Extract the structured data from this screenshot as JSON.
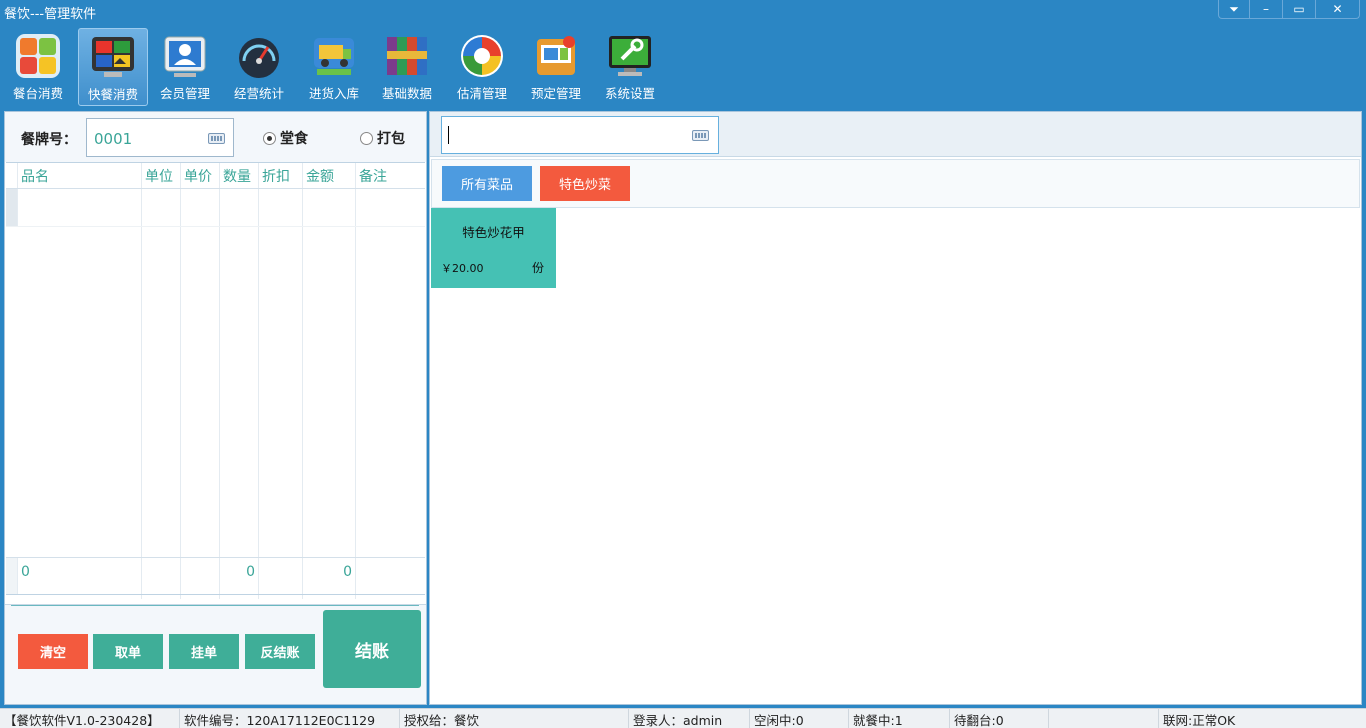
{
  "window": {
    "title": "餐饮---管理软件",
    "controls": {
      "menu": "⏷",
      "minimize": "–",
      "maximize": "▭",
      "close": "✕"
    }
  },
  "toolbar": {
    "items": [
      {
        "label": "餐台消费",
        "icon": "tiles-icon",
        "active": false
      },
      {
        "label": "快餐消费",
        "icon": "fastfood-icon",
        "active": true
      },
      {
        "label": "会员管理",
        "icon": "member-icon",
        "active": false
      },
      {
        "label": "经营统计",
        "icon": "gauge-icon",
        "active": false
      },
      {
        "label": "进货入库",
        "icon": "truck-icon",
        "active": false
      },
      {
        "label": "基础数据",
        "icon": "books-icon",
        "active": false
      },
      {
        "label": "估清管理",
        "icon": "refresh-globe-icon",
        "active": false
      },
      {
        "label": "预定管理",
        "icon": "reservation-icon",
        "active": false
      },
      {
        "label": "系统设置",
        "icon": "settings-monitor-icon",
        "active": false
      }
    ]
  },
  "order": {
    "tag_label": "餐牌号：",
    "tag_value": "0001",
    "dine_in": "堂食",
    "takeaway": "打包",
    "mode_selected": "dine_in",
    "columns": [
      "品名",
      "单位",
      "单价",
      "数量",
      "折扣",
      "金额",
      "备注"
    ],
    "totals": {
      "name": "0",
      "qty": "0",
      "amount": "0"
    }
  },
  "actions": {
    "clear": "清空",
    "fetch": "取单",
    "hold": "挂单",
    "reverse": "反结账",
    "checkout": "结账"
  },
  "menu": {
    "search_value": "",
    "categories": [
      "所有菜品",
      "特色炒菜"
    ],
    "dishes": [
      {
        "name": "特色炒花甲",
        "price": "￥20.00",
        "unit": "份"
      }
    ]
  },
  "status": {
    "version": "【餐饮软件V1.0-230428】",
    "serial": "软件编号：120A17112E0C1129",
    "licensed": "授权给：餐饮",
    "user": "登录人：admin",
    "idle": "空闲中:0",
    "dining": "就餐中:1",
    "turnover": "待翻台:0",
    "blank": "",
    "network": "联网:正常OK"
  },
  "colors": {
    "chrome_blue": "#2b86c4",
    "accent_green": "#3fae98",
    "accent_red": "#f35a3e",
    "category_blue": "#4d9be0",
    "dish_tile": "#45c1b4"
  }
}
